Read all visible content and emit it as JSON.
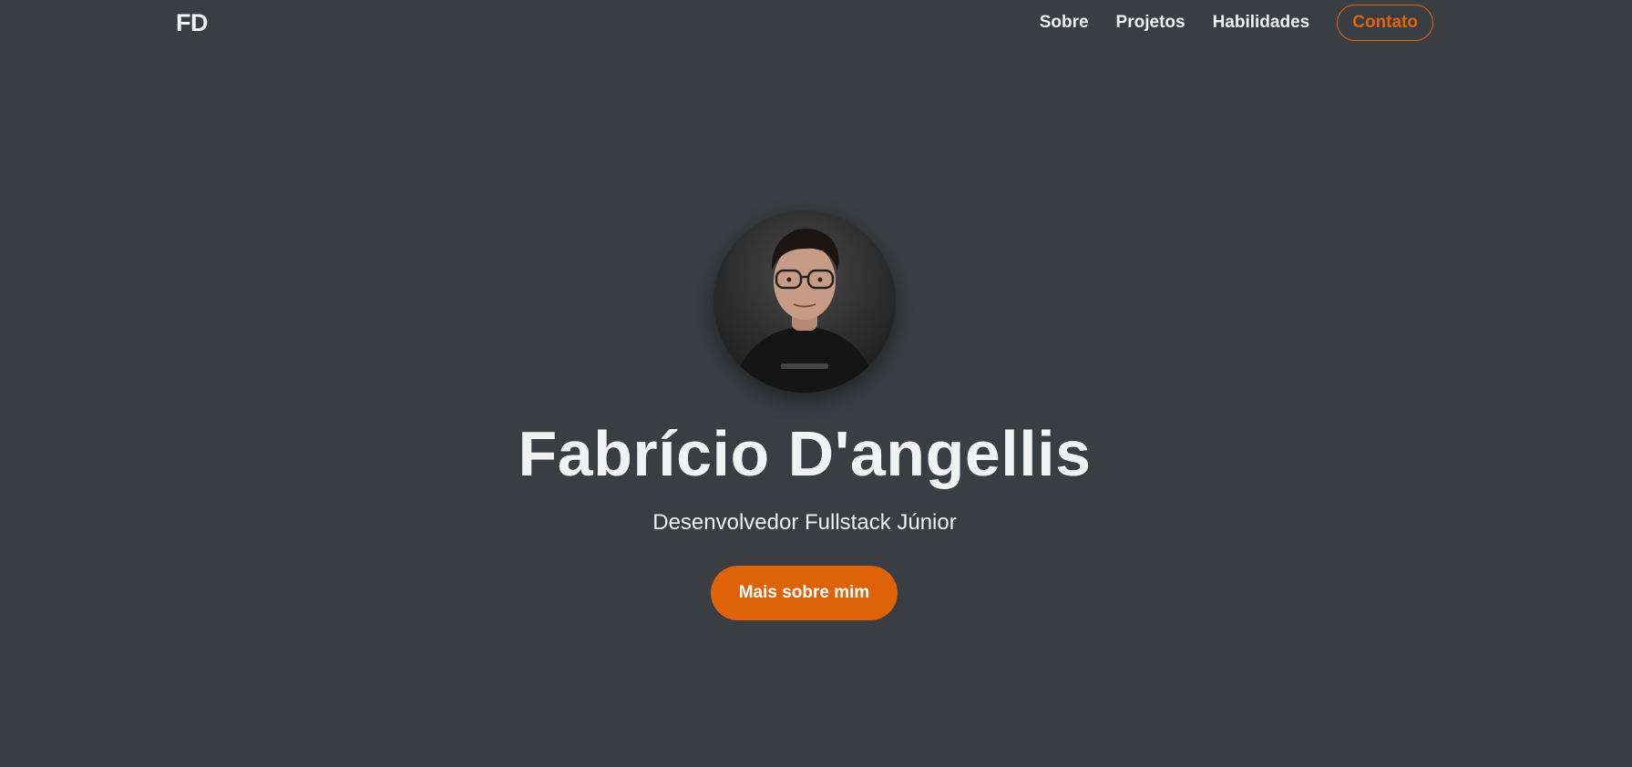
{
  "nav": {
    "logo": "FD",
    "links": [
      "Sobre",
      "Projetos",
      "Habilidades"
    ],
    "contact": "Contato"
  },
  "hero": {
    "avatar_icon": "profile-photo",
    "name": "Fabrício D'angellis",
    "subtitle": "Desenvolvedor Fullstack Júnior",
    "cta": "Mais sobre mim"
  },
  "colors": {
    "background": "#3a3e43",
    "accent": "#dd6209",
    "text": "#f2f2f2"
  }
}
